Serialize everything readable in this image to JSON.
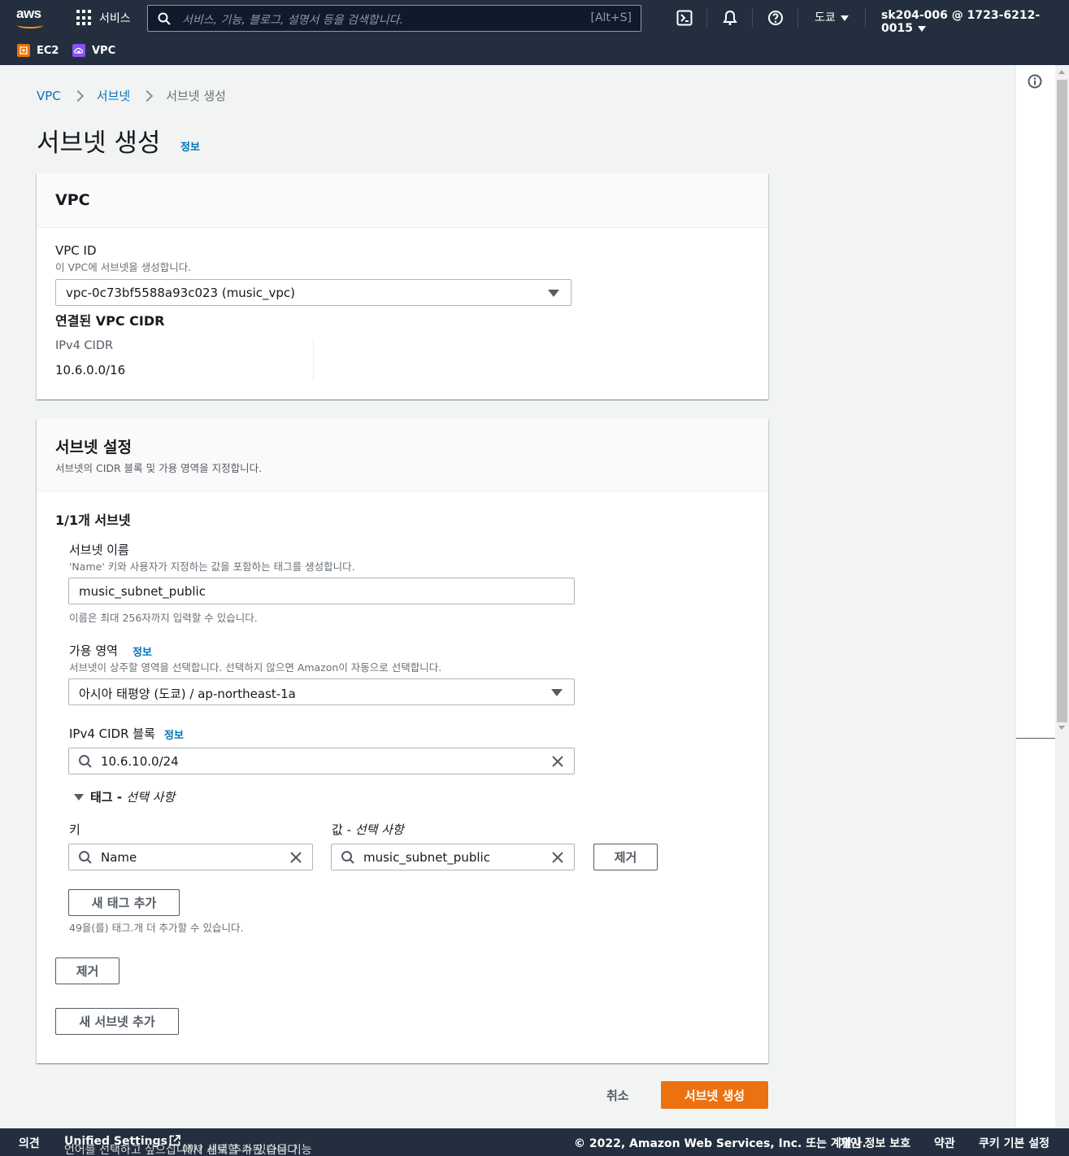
{
  "nav": {
    "logo": "aws",
    "services": "서비스",
    "search_placeholder": "서비스, 기능, 블로그, 설명서 등을 검색합니다.",
    "search_shortcut": "[Alt+S]",
    "region": "도쿄",
    "account": "sk204-006 @ 1723-6212-0015",
    "favorites": [
      {
        "label": "EC2",
        "color": "#ed7100"
      },
      {
        "label": "VPC",
        "color": "#8c4fff"
      }
    ]
  },
  "breadcrumb": {
    "items": [
      "VPC",
      "서브넷"
    ],
    "current": "서브넷 생성"
  },
  "page": {
    "title": "서브넷 생성",
    "info": "정보"
  },
  "vpc_panel": {
    "title": "VPC",
    "vpc_id_label": "VPC ID",
    "vpc_id_desc": "이 VPC에 서브넷을 생성합니다.",
    "vpc_id_value": "vpc-0c73bf5588a93c023 (music_vpc)",
    "cidr_heading": "연결된 VPC CIDR",
    "ipv4_label": "IPv4 CIDR",
    "ipv4_value": "10.6.0.0/16"
  },
  "subnet_panel": {
    "title": "서브넷 설정",
    "desc": "서브넷의 CIDR 블록 및 가용 영역을 지정합니다.",
    "count": "1/1개 서브넷",
    "name_label": "서브넷 이름",
    "name_desc": "'Name' 키와 사용자가 지정하는 값을 포함하는 태그를 생성합니다.",
    "name_value": "music_subnet_public",
    "name_hint": "이름은 최대 256자까지 입력할 수 있습니다.",
    "az_label": "가용 영역",
    "az_info": "정보",
    "az_desc": "서브넷이 상주할 영역을 선택합니다. 선택하지 않으면 Amazon이 자동으로 선택합니다.",
    "az_value": "아시아 태평양 (도쿄) / ap-northeast-1a",
    "cidr_label": "IPv4 CIDR 블록",
    "cidr_info": "정보",
    "cidr_value": "10.6.10.0/24",
    "tags_toggle": "태그 - ",
    "tags_optional": "선택 사항",
    "key_label": "키",
    "value_label": "값 - ",
    "value_optional": "선택 사항",
    "tag_key": "Name",
    "tag_value": "music_subnet_public",
    "remove_tag": "제거",
    "add_tag": "새 태그 추가",
    "tags_hint": "49을(를) 태그.개 더 추가할 수 있습니다.",
    "remove_subnet": "제거",
    "add_subnet": "새 서브넷 추가"
  },
  "actions": {
    "cancel": "취소",
    "create": "서브넷 생성"
  },
  "footer": {
    "feedback": "의견",
    "lang_msg_1": "언어를 선택하고 싶으십니까? 새로 추가된 다음 기능",
    "unified": "Unified Settings",
    "lang_msg_2": "에서 선택할 수 있습니다.",
    "copyright": "© 2022, Amazon Web Services, Inc. 또는 계열사.",
    "privacy": "개인 정보 보호",
    "terms": "약관",
    "cookies": "쿠키 기본 설정"
  }
}
